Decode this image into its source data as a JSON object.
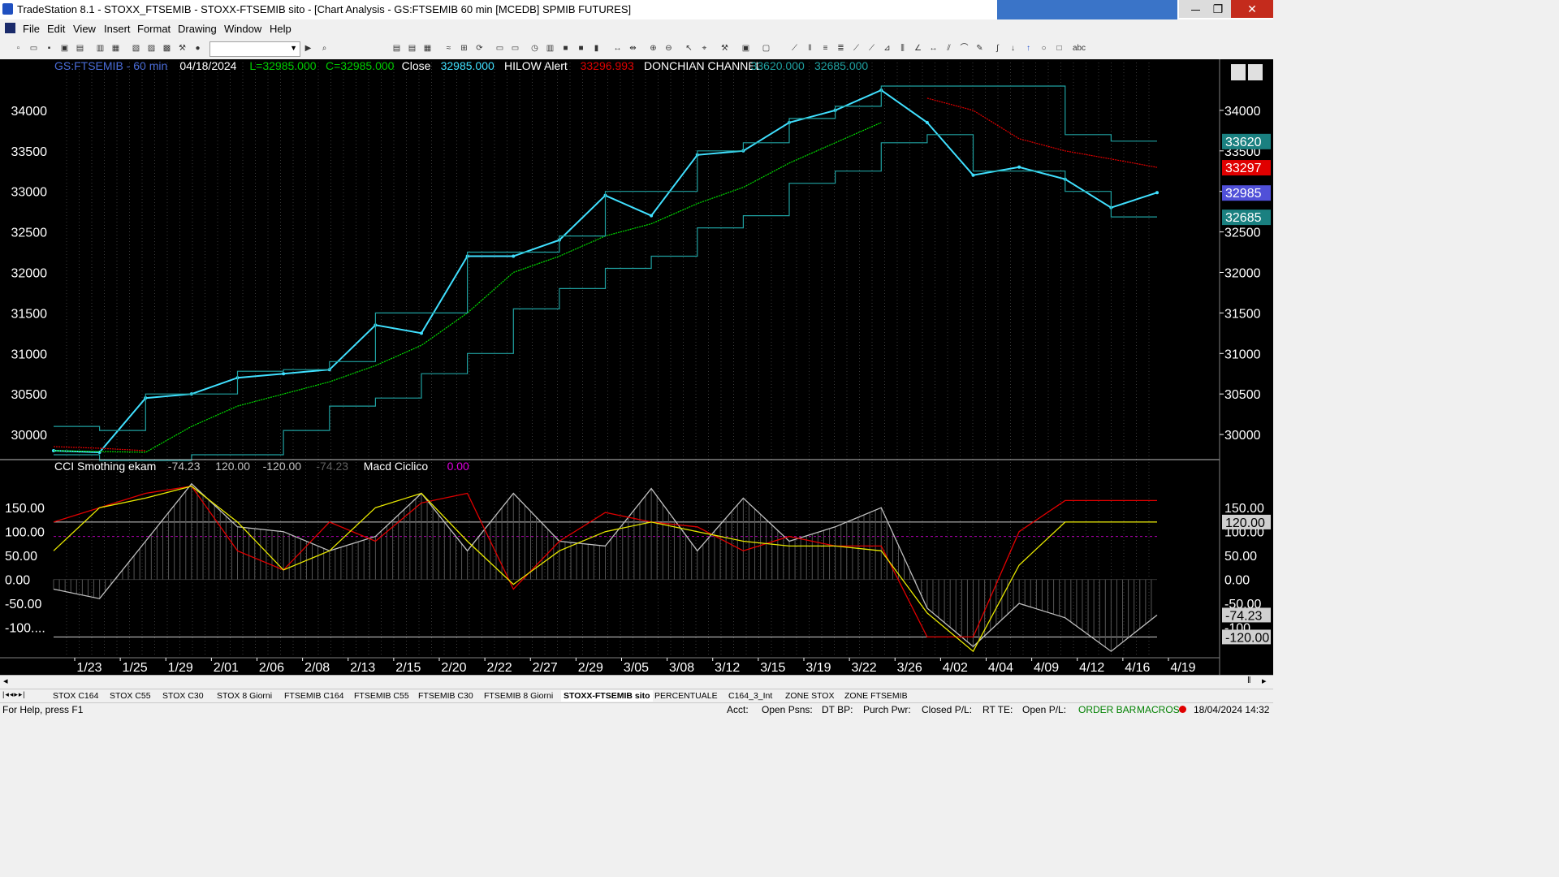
{
  "window": {
    "title": "TradeStation 8.1 - STOXX_FTSEMIB - STOXX-FTSEMIB sito - [Chart Analysis - GS:FTSEMIB  60 min  [MCEDB] SPMIB FUTURES]",
    "min_glyph": "—",
    "max_glyph": "❐",
    "close_glyph": "✕"
  },
  "menu": [
    "File",
    "Edit",
    "View",
    "Insert",
    "Format",
    "Drawing",
    "Window",
    "Help"
  ],
  "price_panel": {
    "header": [
      {
        "text": "GS:FTSEMIB - 60 min",
        "color": "#4a6cd8"
      },
      {
        "text": "04/18/2024",
        "color": "#ffffff"
      },
      {
        "text": "L=32985.000",
        "color": "#00cc00"
      },
      {
        "text": "C=32985.000",
        "color": "#00cc00"
      },
      {
        "text": "Close",
        "color": "#ffffff"
      },
      {
        "text": "32985.000",
        "color": "#40e0ff"
      },
      {
        "text": "HILOW Alert",
        "color": "#ffffff"
      },
      {
        "text": "33296.993",
        "color": "#e00000"
      },
      {
        "text": "DONCHIAN CHANNEL",
        "color": "#ffffff"
      },
      {
        "text": "33620.000",
        "color": "#1fa0a0"
      },
      {
        "text": "32685.000",
        "color": "#1fa0a0"
      }
    ],
    "y_ticks": [
      30000,
      30500,
      31000,
      31500,
      32000,
      32500,
      33000,
      33500,
      34000
    ],
    "y_range": [
      29700,
      34450
    ],
    "last_values": [
      {
        "text": "33620",
        "bg": "#1a8080",
        "value": 33620
      },
      {
        "text": "33297",
        "bg": "#e00000",
        "value": 33297
      },
      {
        "text": "32985",
        "bg": "#5050d8",
        "value": 32985
      },
      {
        "text": "32685",
        "bg": "#1a8080",
        "value": 32685
      }
    ]
  },
  "oscillator_panel": {
    "header": [
      {
        "text": "CCI Smothing ekam",
        "color": "#ffffff"
      },
      {
        "text": "-74.23",
        "color": "#c0c0c0"
      },
      {
        "text": "120.00",
        "color": "#c0c0c0"
      },
      {
        "text": "-120.00",
        "color": "#c0c0c0"
      },
      {
        "text": "-74.23",
        "color": "#606060"
      },
      {
        "text": "Macd Ciclico",
        "color": "#ffffff"
      },
      {
        "text": "0.00",
        "color": "#e000e0"
      }
    ],
    "y_ticks": [
      "150.00",
      "100.00",
      "50.00",
      "0.00",
      "-50.00",
      "-100...."
    ],
    "y_tick_values": [
      150,
      100,
      50,
      0,
      -50,
      -100
    ],
    "y_range": [
      -160,
      225
    ],
    "last_values": [
      {
        "text": "120.00",
        "bg": "#d0d0d0",
        "value": 120
      },
      {
        "text": "-74.23",
        "bg": "#d0d0d0",
        "value": -74.23
      },
      {
        "text": "-120.00",
        "bg": "#d0d0d0",
        "value": -120
      }
    ]
  },
  "x_axis": [
    "1/23",
    "1/25",
    "1/29",
    "2/01",
    "2/06",
    "2/08",
    "2/13",
    "2/15",
    "2/20",
    "2/22",
    "2/27",
    "2/29",
    "3/05",
    "3/08",
    "3/12",
    "3/15",
    "3/19",
    "3/22",
    "3/26",
    "4/02",
    "4/04",
    "4/09",
    "4/12",
    "4/16",
    "4/19"
  ],
  "chart_data": [
    {
      "type": "line",
      "title": "GS:FTSEMIB - 60 min",
      "x": [
        "1/23",
        "1/25",
        "1/29",
        "2/01",
        "2/06",
        "2/08",
        "2/13",
        "2/15",
        "2/20",
        "2/22",
        "2/27",
        "2/29",
        "3/05",
        "3/08",
        "3/12",
        "3/15",
        "3/19",
        "3/22",
        "3/26",
        "4/02",
        "4/04",
        "4/09",
        "4/12",
        "4/16",
        "4/18"
      ],
      "ylim": [
        29700,
        34450
      ],
      "series": [
        {
          "name": "Close",
          "color": "#40e0ff",
          "values": [
            29800,
            29780,
            30450,
            30500,
            30700,
            30750,
            30800,
            31350,
            31250,
            32200,
            32200,
            32400,
            32950,
            32700,
            33450,
            33500,
            33850,
            34000,
            34250,
            33850,
            33200,
            33300,
            33150,
            32800,
            32985
          ]
        },
        {
          "name": "HILOW Alert",
          "color": "#e00000",
          "values": [
            29850,
            29830,
            29800,
            null,
            null,
            null,
            null,
            null,
            null,
            null,
            null,
            null,
            null,
            null,
            null,
            null,
            null,
            null,
            null,
            34150,
            34000,
            33650,
            33500,
            33400,
            33297
          ]
        },
        {
          "name": "Average",
          "color": "#00dd00",
          "values": [
            29800,
            29790,
            29780,
            30100,
            30350,
            30500,
            30650,
            30850,
            31100,
            31500,
            32000,
            32200,
            32450,
            32600,
            32850,
            33050,
            33350,
            33600,
            33850,
            null,
            null,
            null,
            null,
            null,
            null
          ]
        },
        {
          "name": "DONCHIAN CHANNEL upper",
          "color": "#1fa0a0",
          "values": [
            30100,
            30050,
            30500,
            30500,
            30780,
            30800,
            30900,
            31500,
            31500,
            32250,
            32250,
            32450,
            33000,
            33000,
            33500,
            33600,
            33900,
            34050,
            34300,
            34300,
            34300,
            34300,
            33700,
            33620,
            33620
          ]
        },
        {
          "name": "DONCHIAN CHANNEL lower",
          "color": "#1fa0a0",
          "values": [
            29750,
            29680,
            29680,
            29750,
            29750,
            30050,
            30350,
            30450,
            30750,
            31000,
            31550,
            31800,
            32050,
            32200,
            32550,
            32700,
            33100,
            33250,
            33600,
            33700,
            33250,
            33250,
            33000,
            32685,
            32685
          ]
        }
      ]
    },
    {
      "type": "line",
      "title": "CCI Smothing ekam",
      "x": [
        "1/23",
        "1/25",
        "1/29",
        "2/01",
        "2/06",
        "2/08",
        "2/13",
        "2/15",
        "2/20",
        "2/22",
        "2/27",
        "2/29",
        "3/05",
        "3/08",
        "3/12",
        "3/15",
        "3/19",
        "3/22",
        "3/26",
        "4/02",
        "4/04",
        "4/09",
        "4/12",
        "4/16",
        "4/18"
      ],
      "ylim": [
        -160,
        225
      ],
      "series": [
        {
          "name": "CCI",
          "color": "#c0c0c0",
          "values": [
            -20,
            -40,
            80,
            200,
            110,
            100,
            60,
            90,
            180,
            60,
            180,
            80,
            70,
            190,
            60,
            170,
            80,
            110,
            150,
            -60,
            -140,
            -50,
            -80,
            -150,
            -74.23
          ]
        },
        {
          "name": "Red",
          "color": "#e00000",
          "values": [
            120,
            150,
            180,
            195,
            60,
            20,
            120,
            80,
            160,
            180,
            -20,
            80,
            140,
            120,
            110,
            60,
            90,
            70,
            70,
            -120,
            -120,
            100,
            165,
            165,
            165
          ]
        },
        {
          "name": "Yellow",
          "color": "#e8e800",
          "values": [
            60,
            150,
            170,
            195,
            120,
            20,
            60,
            150,
            180,
            80,
            -10,
            60,
            100,
            120,
            100,
            80,
            70,
            70,
            60,
            -70,
            -150,
            30,
            120,
            120,
            120
          ]
        }
      ],
      "hlines": [
        120,
        -120,
        90
      ],
      "markers": [
        {
          "type": "up-arrow",
          "color": "#ffff00"
        },
        {
          "type": "down-arrow",
          "color": "#ff2020"
        }
      ]
    }
  ],
  "tabs": [
    "STOX C164",
    "STOX C55",
    "STOX  C30",
    "STOX  8 Giorni",
    "FTSEMIB C164",
    "FTSEMIB C55",
    "FTSEMIB C30",
    "FTSEMIB  8 Giorni",
    "STOXX-FTSEMIB sito",
    "PERCENTUALE",
    "C164_3_Int",
    "ZONE STOX",
    "ZONE FTSEMIB"
  ],
  "active_tab": 8,
  "status": {
    "help": "For Help, press F1",
    "acct": "Acct:",
    "open_psns": "Open Psns:",
    "dt_bp": "DT BP:",
    "purch_pwr": "Purch Pwr:",
    "closed_pl": "Closed P/L:",
    "rt_te": "RT TE:",
    "open_pl": "Open P/L:",
    "order_bar": "ORDER BAR",
    "macros": "MACROS",
    "datetime": "18/04/2024 14:32"
  }
}
